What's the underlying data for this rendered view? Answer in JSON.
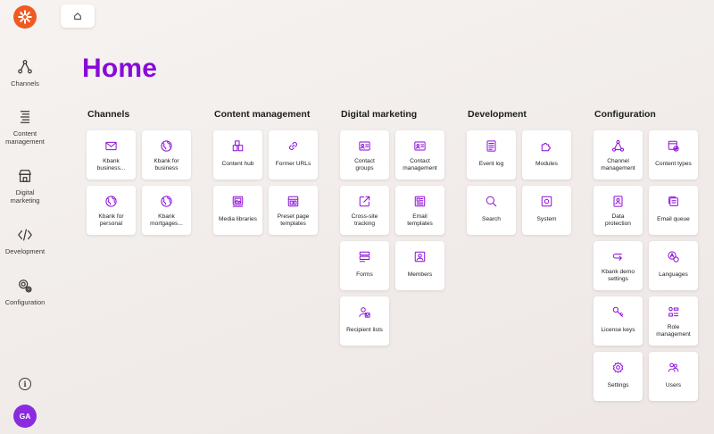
{
  "rail": {
    "items": [
      {
        "label": "Channels",
        "icon": "channels-icon"
      },
      {
        "label": "Content\nmanagement",
        "icon": "content-management-icon"
      },
      {
        "label": "Digital\nmarketing",
        "icon": "digital-marketing-icon"
      },
      {
        "label": "Development",
        "icon": "development-icon"
      },
      {
        "label": "Configuration",
        "icon": "configuration-icon"
      }
    ],
    "info": "i",
    "avatar": "GA"
  },
  "page": {
    "title": "Home"
  },
  "colors": {
    "accent": "#8a0ad8",
    "logo": "#f05a22",
    "avatar": "#8a2be2"
  },
  "sections": [
    {
      "title": "Channels",
      "tiles": [
        {
          "label": "Kbank\nbusiness...",
          "icon": "mail-icon"
        },
        {
          "label": "Kbank for\nbusiness",
          "icon": "globe-icon"
        },
        {
          "label": "Kbank for\npersonal",
          "icon": "globe-icon"
        },
        {
          "label": "Kbank\nmortgages...",
          "icon": "globe-icon"
        }
      ]
    },
    {
      "title": "Content management",
      "tiles": [
        {
          "label": "Content hub",
          "icon": "content-hub-icon"
        },
        {
          "label": "Former URLs",
          "icon": "link-icon"
        },
        {
          "label": "Media libraries",
          "icon": "media-library-icon"
        },
        {
          "label": "Preset page\ntemplates",
          "icon": "page-template-icon"
        }
      ]
    },
    {
      "title": "Digital marketing",
      "tiles": [
        {
          "label": "Contact\ngroups",
          "icon": "contact-card-icon"
        },
        {
          "label": "Contact\nmanagement",
          "icon": "contact-card-icon"
        },
        {
          "label": "Cross-site\ntracking",
          "icon": "external-link-icon"
        },
        {
          "label": "Email\ntemplates",
          "icon": "email-template-icon"
        },
        {
          "label": "Forms",
          "icon": "forms-icon"
        },
        {
          "label": "Members",
          "icon": "member-icon"
        },
        {
          "label": "Recipient lists",
          "icon": "recipient-list-icon"
        }
      ]
    },
    {
      "title": "Development",
      "tiles": [
        {
          "label": "Event log",
          "icon": "document-icon"
        },
        {
          "label": "Modules",
          "icon": "puzzle-icon"
        },
        {
          "label": "Search",
          "icon": "search-icon"
        },
        {
          "label": "System",
          "icon": "system-icon"
        }
      ]
    },
    {
      "title": "Configuration",
      "tiles": [
        {
          "label": "Channel\nmanagement",
          "icon": "channels-icon"
        },
        {
          "label": "Content types",
          "icon": "content-types-icon"
        },
        {
          "label": "Data\nprotection",
          "icon": "data-protection-icon"
        },
        {
          "label": "Email queue",
          "icon": "email-queue-icon"
        },
        {
          "label": "Kbank demo\nsettings",
          "icon": "arrow-return-icon"
        },
        {
          "label": "Languages",
          "icon": "languages-icon"
        },
        {
          "label": "License keys",
          "icon": "key-icon"
        },
        {
          "label": "Role\nmanagement",
          "icon": "role-icon"
        },
        {
          "label": "Settings",
          "icon": "gear-icon"
        },
        {
          "label": "Users",
          "icon": "users-icon"
        }
      ]
    }
  ]
}
